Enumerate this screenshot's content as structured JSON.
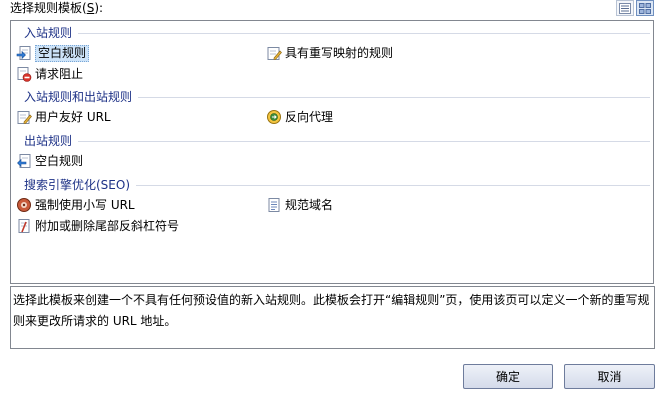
{
  "header": {
    "label": "选择规则模板(",
    "accel": "S",
    "label_suffix": "):"
  },
  "view_buttons": [
    {
      "icon": "details-view-icon"
    },
    {
      "icon": "tiles-view-icon"
    }
  ],
  "groups": [
    {
      "title": "入站规则"
    },
    {
      "title": "入站规则和出站规则"
    },
    {
      "title": "出站规则"
    },
    {
      "title": "搜索引擎优化(SEO)"
    }
  ],
  "items": [
    {
      "label": "空白规则",
      "icon": "inbound-blank-rule-icon"
    },
    {
      "label": "具有重写映射的规则",
      "icon": "rewrite-map-rule-icon"
    },
    {
      "label": "请求阻止",
      "icon": "request-blocking-icon"
    },
    {
      "label": "用户友好 URL",
      "icon": "friendly-url-icon"
    },
    {
      "label": "反向代理",
      "icon": "reverse-proxy-icon"
    },
    {
      "label": "空白规则",
      "icon": "outbound-blank-rule-icon"
    },
    {
      "label": "强制使用小写 URL",
      "icon": "lowercase-url-icon"
    },
    {
      "label": "规范域名",
      "icon": "canonical-domain-icon"
    },
    {
      "label": "附加或删除尾部反斜杠符号",
      "icon": "trailing-slash-icon"
    }
  ],
  "description": {
    "line1": "选择此模板来创建一个不具有任何预设值的新入站规则。此模板会打开“编辑规则”页，使用该页可以定义一个新的重写规",
    "line2": "则来更改所请求的 URL 地址。"
  },
  "buttons": {
    "ok": "确定",
    "cancel": "取消"
  },
  "colors": {
    "group_header": "#1e3287",
    "selection": "#cde3f8",
    "button_border": "#6e7c9c"
  }
}
